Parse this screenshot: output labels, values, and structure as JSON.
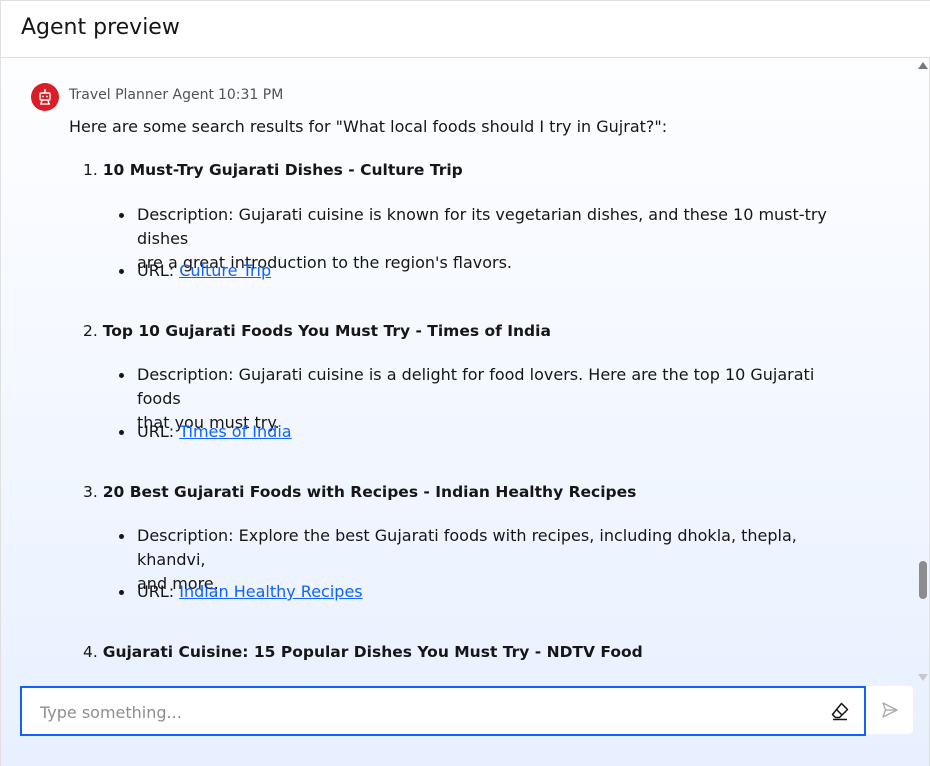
{
  "header": {
    "title": "Agent preview"
  },
  "message": {
    "sender": "Travel Planner Agent",
    "time": "10:31 PM",
    "intro": "Here are some search results for \"What local foods should I try in Gujrat?\":",
    "results": [
      {
        "number": "1.",
        "title": "10 Must-Try Gujarati Dishes - Culture Trip",
        "desc_label": "Description: ",
        "desc_line1": "Gujarati cuisine is known for its vegetarian dishes, and these 10 must-try dishes",
        "desc_line2": "are a great introduction to the region's flavors.",
        "url_label": "URL: ",
        "link": "Culture Trip"
      },
      {
        "number": "2.",
        "title": "Top 10 Gujarati Foods You Must Try - Times of India",
        "desc_label": "Description: ",
        "desc_line1": "Gujarati cuisine is a delight for food lovers. Here are the top 10 Gujarati foods",
        "desc_line2": "that you must try.",
        "url_label": "URL: ",
        "link": "Times of India"
      },
      {
        "number": "3.",
        "title": "20 Best Gujarati Foods with Recipes - Indian Healthy Recipes",
        "desc_label": "Description: ",
        "desc_line1": "Explore the best Gujarati foods with recipes, including dhokla, thepla, khandvi,",
        "desc_line2": "and more.",
        "url_label": "URL: ",
        "link": "Indian Healthy Recipes"
      },
      {
        "number": "4.",
        "title": "Gujarati Cuisine: 15 Popular Dishes You Must Try - NDTV Food"
      }
    ]
  },
  "input": {
    "placeholder": "Type something..."
  },
  "icons": {
    "avatar": "robot-icon",
    "clear": "eraser-icon",
    "send": "send-icon"
  },
  "colors": {
    "accent": "#0f62fe",
    "avatar_bg": "#da1e28",
    "link": "#0f62fe"
  }
}
